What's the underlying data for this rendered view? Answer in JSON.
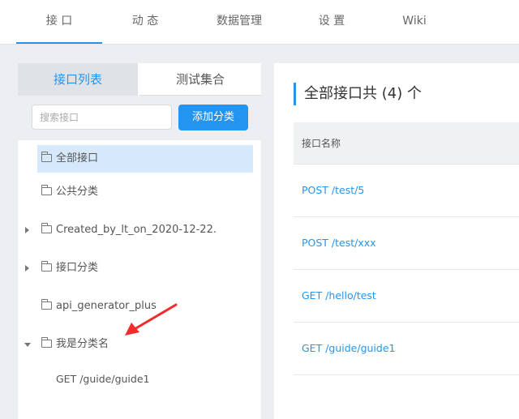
{
  "topnav": {
    "tabs": [
      {
        "label": "接 口"
      },
      {
        "label": "动 态"
      },
      {
        "label": "数据管理"
      },
      {
        "label": "设 置"
      },
      {
        "label": "Wiki"
      }
    ]
  },
  "sidebar": {
    "tabs": [
      "接口列表",
      "测试集合"
    ],
    "search_placeholder": "搜索接口",
    "add_button": "添加分类",
    "tree": [
      {
        "label": "全部接口",
        "selected": true,
        "expandable": false
      },
      {
        "label": "公共分类",
        "expandable": false
      },
      {
        "label": "Created_by_lt_on_2020-12-22.",
        "expandable": true,
        "expanded": false
      },
      {
        "label": "接口分类",
        "expandable": true,
        "expanded": false
      },
      {
        "label": "api_generator_plus",
        "expandable": false
      },
      {
        "label": "我是分类名",
        "expandable": true,
        "expanded": true
      },
      {
        "label": "GET /guide/guide1",
        "leaf": true
      }
    ]
  },
  "main": {
    "title": "全部接口共 (4) 个",
    "column_header": "接口名称",
    "rows": [
      "POST /test/5",
      "POST /test/xxx",
      "GET /hello/test",
      "GET /guide/guide1"
    ]
  },
  "colors": {
    "accent": "#2395f1",
    "selected_bg": "#d6e9fb",
    "annotation_arrow": "#f22c2c"
  },
  "icons": [
    "folder-icon",
    "caret-right-icon",
    "caret-down-icon",
    "red-arrow-annotation"
  ]
}
